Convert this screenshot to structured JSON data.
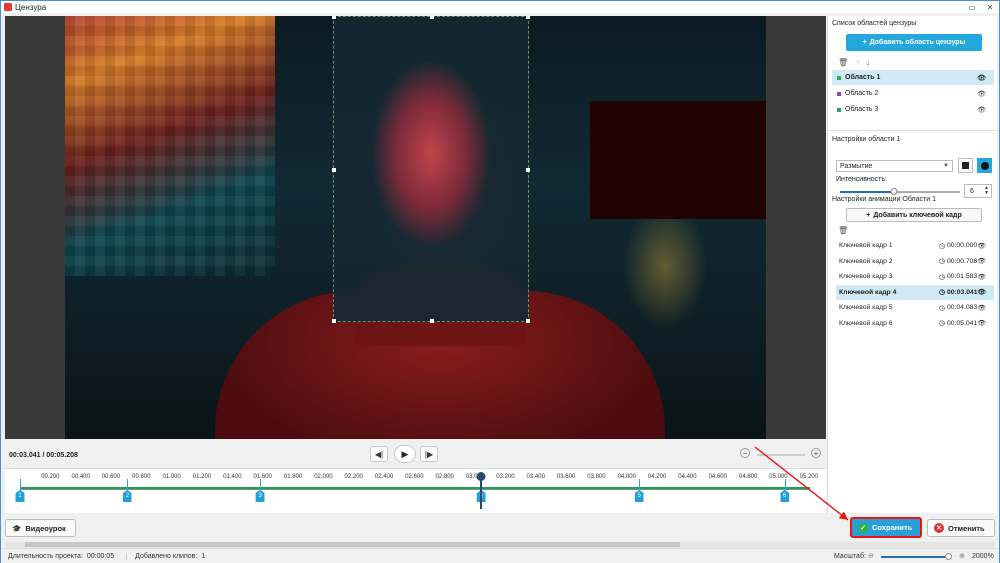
{
  "window": {
    "title": "Цензура"
  },
  "playback": {
    "current": "00:03.041",
    "separator": " / ",
    "total": "00:05.208"
  },
  "timeline": {
    "ticks": [
      "00.200",
      "00.400",
      "00.600",
      "00.800",
      "01.000",
      "01.200",
      "01.400",
      "01.600",
      "01.800",
      "02.000",
      "02.200",
      "02.400",
      "02.600",
      "02.800",
      "03.000",
      "03.200",
      "03.400",
      "03.600",
      "03.800",
      "04.000",
      "04.200",
      "04.400",
      "04.600",
      "04.800",
      "05.000",
      "05.200"
    ],
    "keyframes": [
      "1",
      "2",
      "3",
      "4",
      "5",
      "6"
    ]
  },
  "buttons": {
    "tutorial": "Видеоурок",
    "save": "Сохранить",
    "cancel": "Отменить"
  },
  "status": {
    "duration_label": "Длительность проекта:",
    "duration_value": "00:00:05",
    "clips_label": "Добавлено клипов:",
    "clips_value": "1",
    "zoom_label": "Масштаб:",
    "zoom_value": "2000%"
  },
  "panel": {
    "areas_title": "Список областей цензуры",
    "add_area": "Добавить область цензуры",
    "areas": [
      {
        "name": "Область 1",
        "color": "#2db34a",
        "selected": true
      },
      {
        "name": "Область 2",
        "color": "#9b3fb5",
        "selected": false
      },
      {
        "name": "Область 3",
        "color": "#1fa37a",
        "selected": false
      }
    ],
    "settings_title": "Настройки области 1",
    "effect_value": "Размытие",
    "intensity_label": "Интенсивность:",
    "intensity_value": "6",
    "intensity_fraction": 0.45,
    "anim_title": "Настройки анимации Области 1",
    "add_keyframe": "Добавить ключевой кадр",
    "keyframes": [
      {
        "name": "Ключевой кадр 1",
        "time": "00:00.000",
        "selected": false
      },
      {
        "name": "Ключевой кадр 2",
        "time": "00:00.708",
        "selected": false
      },
      {
        "name": "Ключевой кадр 3",
        "time": "00:01.583",
        "selected": false
      },
      {
        "name": "Ключевой кадр 4",
        "time": "00:03.041",
        "selected": true
      },
      {
        "name": "Ключевой кадр 5",
        "time": "00:04.083",
        "selected": false
      },
      {
        "name": "Ключевой кадр 6",
        "time": "00:05.041",
        "selected": false
      }
    ]
  },
  "colors": {
    "accent": "#24a7dc",
    "save_highlight": "#e11111",
    "track": "#17a44a"
  }
}
